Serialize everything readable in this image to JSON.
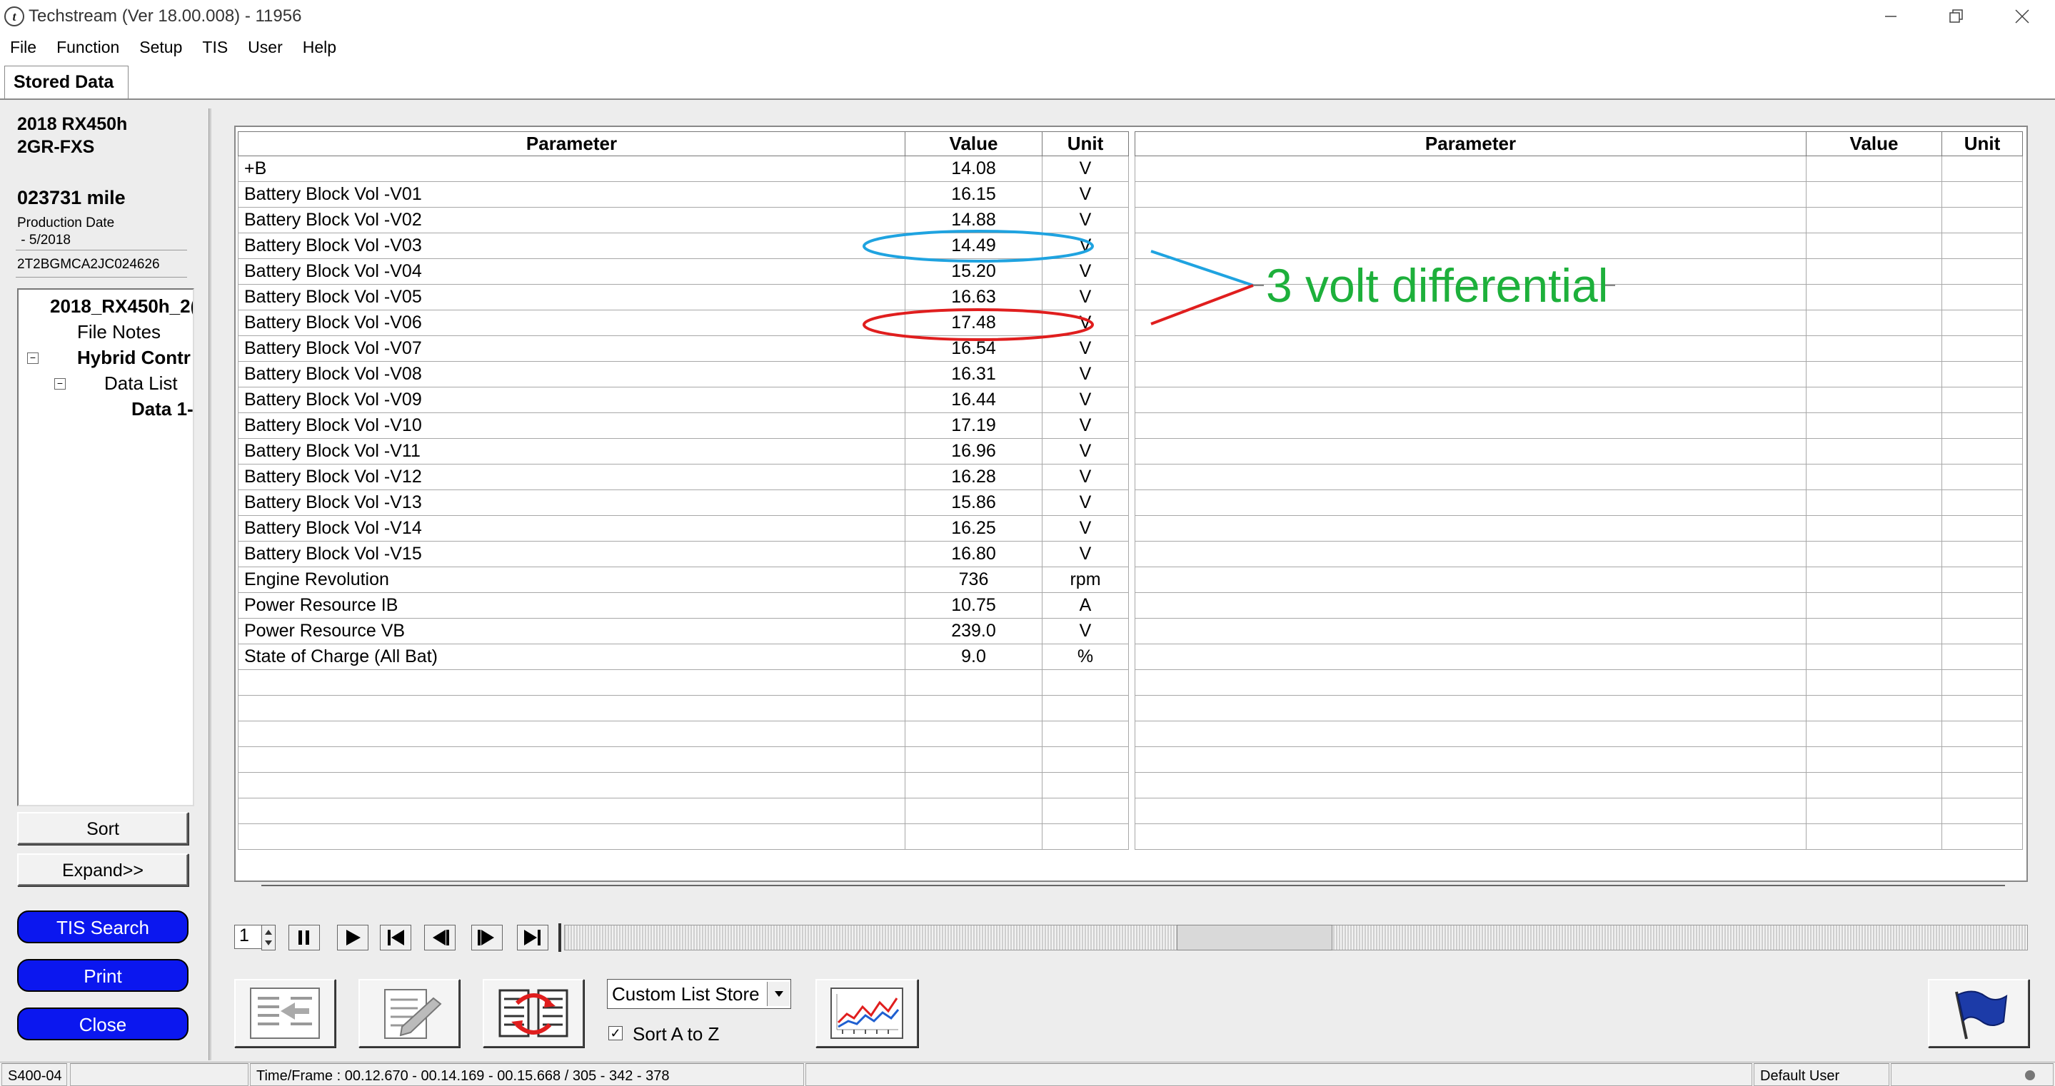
{
  "window": {
    "title": "Techstream (Ver 18.00.008) - 11956"
  },
  "menu": [
    "File",
    "Function",
    "Setup",
    "TIS",
    "User",
    "Help"
  ],
  "tab": {
    "label": "Stored Data"
  },
  "vehicle": {
    "model": "2018 RX450h",
    "engine": "2GR-FXS",
    "mileage": "023731 mile",
    "production_label": "Production Date",
    "production_date": " - 5/2018",
    "vin": "2T2BGMCA2JC024626"
  },
  "tree": {
    "root": "2018_RX450h_2(",
    "file_notes": "File Notes",
    "hybrid": "Hybrid Contr",
    "data_list": "Data List",
    "data_item": "Data 1-",
    "toggle_symbol": "−"
  },
  "left_buttons": {
    "sort": "Sort",
    "expand": "Expand>>",
    "tis_search": "TIS Search",
    "print": "Print",
    "close": "Close"
  },
  "grid": {
    "headers": {
      "parameter": "Parameter",
      "value": "Value",
      "unit": "Unit"
    },
    "rows": [
      {
        "parameter": "+B",
        "value": "14.08",
        "unit": "V"
      },
      {
        "parameter": "Battery Block Vol -V01",
        "value": "16.15",
        "unit": "V"
      },
      {
        "parameter": "Battery Block Vol -V02",
        "value": "14.88",
        "unit": "V"
      },
      {
        "parameter": "Battery Block Vol -V03",
        "value": "14.49",
        "unit": "V"
      },
      {
        "parameter": "Battery Block Vol -V04",
        "value": "15.20",
        "unit": "V"
      },
      {
        "parameter": "Battery Block Vol -V05",
        "value": "16.63",
        "unit": "V"
      },
      {
        "parameter": "Battery Block Vol -V06",
        "value": "17.48",
        "unit": "V"
      },
      {
        "parameter": "Battery Block Vol -V07",
        "value": "16.54",
        "unit": "V"
      },
      {
        "parameter": "Battery Block Vol -V08",
        "value": "16.31",
        "unit": "V"
      },
      {
        "parameter": "Battery Block Vol -V09",
        "value": "16.44",
        "unit": "V"
      },
      {
        "parameter": "Battery Block Vol -V10",
        "value": "17.19",
        "unit": "V"
      },
      {
        "parameter": "Battery Block Vol -V11",
        "value": "16.96",
        "unit": "V"
      },
      {
        "parameter": "Battery Block Vol -V12",
        "value": "16.28",
        "unit": "V"
      },
      {
        "parameter": "Battery Block Vol -V13",
        "value": "15.86",
        "unit": "V"
      },
      {
        "parameter": "Battery Block Vol -V14",
        "value": "16.25",
        "unit": "V"
      },
      {
        "parameter": "Battery Block Vol -V15",
        "value": "16.80",
        "unit": "V"
      },
      {
        "parameter": "Engine Revolution",
        "value": "736",
        "unit": "rpm"
      },
      {
        "parameter": "Power Resource IB",
        "value": "10.75",
        "unit": "A"
      },
      {
        "parameter": "Power Resource VB",
        "value": "239.0",
        "unit": "V"
      },
      {
        "parameter": "State of Charge (All Bat)",
        "value": "9.0",
        "unit": "%"
      }
    ]
  },
  "annotation": {
    "text": "3 volt differential",
    "low_cell_color": "#1fa3e0",
    "high_cell_color": "#e01e1e",
    "text_color": "#1db03b"
  },
  "playback": {
    "frame": "1"
  },
  "toolbar": {
    "store_select": "Custom List Store",
    "sort_az_label": "Sort A to Z",
    "sort_az_checked": "✓"
  },
  "status": {
    "code": "S400-04",
    "timeframe": "Time/Frame : 00.12.670 - 00.14.169 - 00.15.668 / 305 - 342 - 378",
    "user": "Default User"
  },
  "colors": {
    "blue_button": "#0b17ef",
    "app_gray": "#ededed"
  }
}
